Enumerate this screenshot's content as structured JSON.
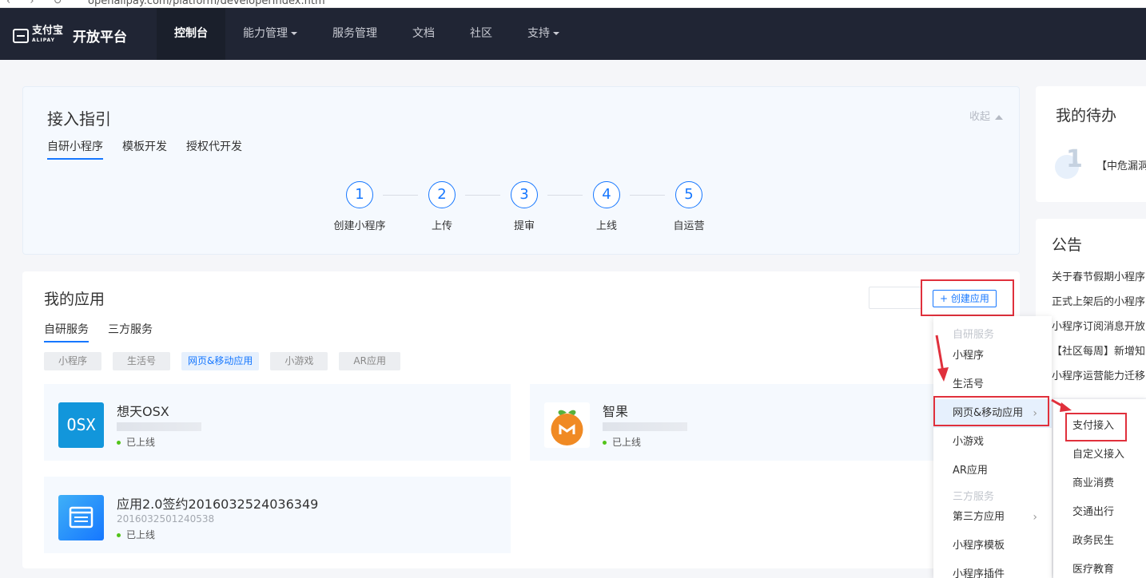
{
  "browser": {
    "url": "openalipay.com/platform/developerIndex.htm"
  },
  "header": {
    "logo_text": "支付宝",
    "logo_sub": "ALIPAY",
    "platform_title": "开放平台",
    "nav": [
      "控制台",
      "能力管理",
      "服务管理",
      "文档",
      "社区",
      "支持"
    ]
  },
  "guide": {
    "title": "接入指引",
    "collapse_label": "收起",
    "tabs": [
      "自研小程序",
      "模板开发",
      "授权代开发"
    ],
    "steps": [
      {
        "num": "1",
        "label": "创建小程序"
      },
      {
        "num": "2",
        "label": "上传"
      },
      {
        "num": "3",
        "label": "提审"
      },
      {
        "num": "4",
        "label": "上线"
      },
      {
        "num": "5",
        "label": "自运营"
      }
    ]
  },
  "apps": {
    "title": "我的应用",
    "create_label": "+ 创建应用",
    "tabs": [
      "自研服务",
      "三方服务"
    ],
    "filters": [
      "小程序",
      "生活号",
      "网页&移动应用",
      "小游戏",
      "AR应用"
    ],
    "items": [
      {
        "name": "想天OSX",
        "icon_text": "OSX",
        "status": "已上线"
      },
      {
        "name": "智果",
        "status": "已上线"
      },
      {
        "name": "应用2.0签约2016032524036349",
        "id": "2016032501240538",
        "status": "已上线"
      }
    ]
  },
  "todo": {
    "title": "我的待办",
    "count": "1",
    "item": "【中危漏洞"
  },
  "notice": {
    "title": "公告",
    "items": [
      "关于春节假期小程序",
      "正式上架后的小程序",
      "小程序订阅消息开放",
      "【社区每周】新增知",
      "小程序运营能力迁移"
    ]
  },
  "create_menu": {
    "group1": "自研服务",
    "items1": [
      "小程序",
      "生活号",
      "网页&移动应用",
      "小游戏",
      "AR应用"
    ],
    "group2": "三方服务",
    "items2": [
      "第三方应用",
      "小程序模板",
      "小程序插件"
    ]
  },
  "submenu": [
    "支付接入",
    "自定义接入",
    "商业消费",
    "交通出行",
    "政务民生",
    "医疗教育"
  ],
  "colors": {
    "accent": "#1677ff",
    "header_bg": "#202534",
    "highlight_red": "#e0303c",
    "online_green": "#52c41a"
  }
}
